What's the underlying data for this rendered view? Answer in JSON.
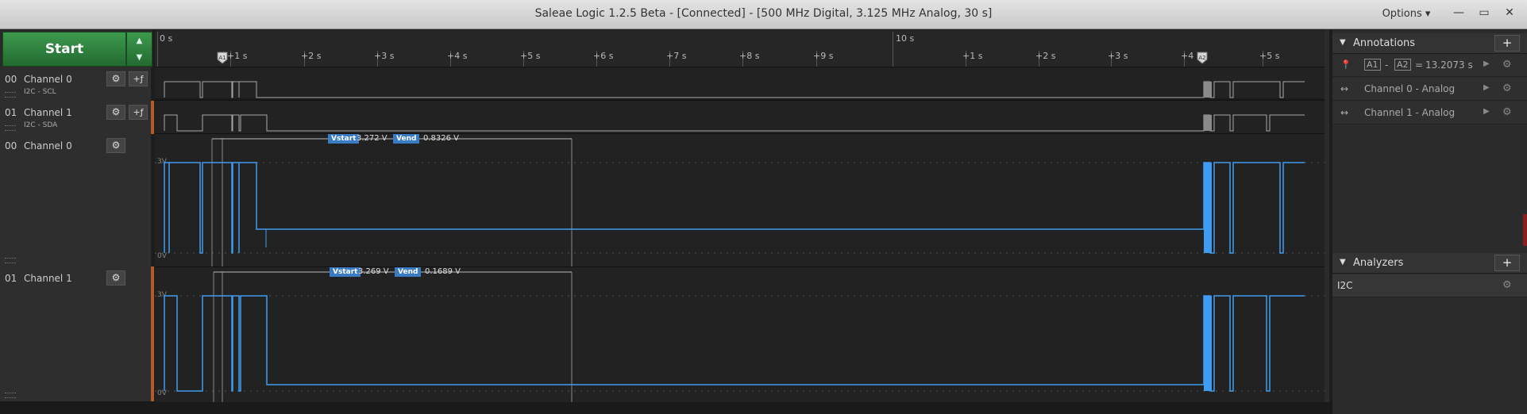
{
  "window": {
    "title": "Saleae Logic 1.2.5 Beta - [Connected] - [500 MHz Digital, 3.125 MHz Analog, 30 s]",
    "options_label": "Options ▾",
    "minimize": "—",
    "restore": "▭",
    "close": "✕"
  },
  "capture": {
    "start_label": "Start"
  },
  "channels": {
    "digital0": {
      "num": "00",
      "name": "Channel 0",
      "sub": "I2C - SCL"
    },
    "digital1": {
      "num": "01",
      "name": "Channel 1",
      "sub": "I2C - SDA"
    },
    "analog0": {
      "num": "00",
      "name": "Channel 0"
    },
    "analog1": {
      "num": "01",
      "name": "Channel 1"
    }
  },
  "ruler": {
    "major": [
      "0 s",
      "10 s"
    ],
    "minor": [
      "+1 s",
      "+2 s",
      "+3 s",
      "+4 s",
      "+5 s",
      "+6 s",
      "+7 s",
      "+8 s",
      "+9 s",
      "+1 s",
      "+2 s",
      "+3 s",
      "+4 s",
      "+5 s"
    ],
    "marker_a1": "A1",
    "marker_a2": "A2"
  },
  "measurements": {
    "ch0": {
      "vstart_tag": "Vstart",
      "vstart": "3.272 V",
      "vend_tag": "Vend",
      "vend": "0.8326 V"
    },
    "ch1": {
      "vstart_tag": "Vstart",
      "vstart": "3.269 V",
      "vend_tag": "Vend",
      "vend": "0.1689 V"
    }
  },
  "analog_axis": {
    "high": "3V",
    "low": "0V"
  },
  "annotations": {
    "title": "Annotations",
    "add": "+",
    "timing": {
      "a1": "A1",
      "dash": "-",
      "a2": "A2",
      "equals": "=",
      "value": "13.2073 s"
    },
    "rows": [
      {
        "label": "Channel 0 - Analog"
      },
      {
        "label": "Channel 1 - Analog"
      }
    ]
  },
  "analyzers": {
    "title": "Analyzers",
    "add": "+",
    "items": [
      {
        "label": "I2C"
      }
    ]
  },
  "colors": {
    "analog": "#3f9cf0",
    "digital": "#a8a8a8",
    "accent": "#b25d25",
    "start": "#2f8a40"
  }
}
